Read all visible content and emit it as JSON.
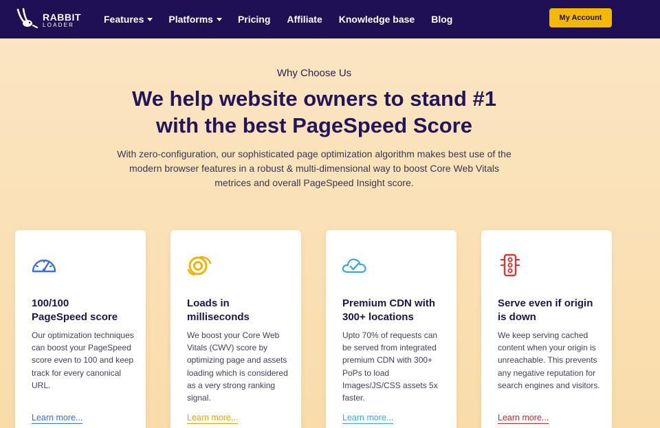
{
  "brand": {
    "name": "RABBIT",
    "sub": "LOADER"
  },
  "nav": {
    "items": [
      {
        "label": "Features",
        "dropdown": true
      },
      {
        "label": "Platforms",
        "dropdown": true
      },
      {
        "label": "Pricing",
        "dropdown": false
      },
      {
        "label": "Affiliate",
        "dropdown": false
      },
      {
        "label": "Knowledge base",
        "dropdown": false
      },
      {
        "label": "Blog",
        "dropdown": false
      }
    ],
    "account_label": "My Account"
  },
  "hero": {
    "eyebrow": "Why Choose Us",
    "title_line1": "We help website owners to stand #1",
    "title_line2": "with the best PageSpeed Score",
    "description": "With zero-configuration, our sophisticated page optimization algorithm makes best use of the modern browser features in a robust & multi-dimensional way to boost Core Web Vitals metrices and overall PageSpeed Insight score."
  },
  "features": [
    {
      "icon": "speedometer-icon",
      "title_line1": "100/100",
      "title_line2": "PageSpeed score",
      "text": "Our optimization techniques can boost your PageSpeed score even to 100 and keep track for every canonical URL.",
      "link": "Learn more...",
      "color": "#3b6fd6"
    },
    {
      "icon": "whirlwind-icon",
      "title_line1": "Loads in",
      "title_line2": "milliseconds",
      "text": "We boost your Core Web Vitals (CWV) score by optimizing page and assets loading which is considered as a very strong ranking signal.",
      "link": "Learn more...",
      "color": "#f0b400"
    },
    {
      "icon": "cloud-check-icon",
      "title_line1": "Premium CDN with",
      "title_line2": "300+ locations",
      "text": "Upto 70% of requests can be served from integrated premium CDN with 300+ PoPs to load Images/JS/CSS assets 5x faster.",
      "link": "Learn more...",
      "color": "#3aa8e0"
    },
    {
      "icon": "traffic-light-icon",
      "title_line1": "Serve even if origin",
      "title_line2": "is down",
      "text": "We keep serving cached content when your origin is unreachable. This prevents any negative reputation for search engines and visitors.",
      "link": "Learn more...",
      "color": "#d23a3a"
    }
  ],
  "colors": {
    "nav_bg": "#1e1052",
    "accent": "#f5b800",
    "heading": "#231559"
  }
}
